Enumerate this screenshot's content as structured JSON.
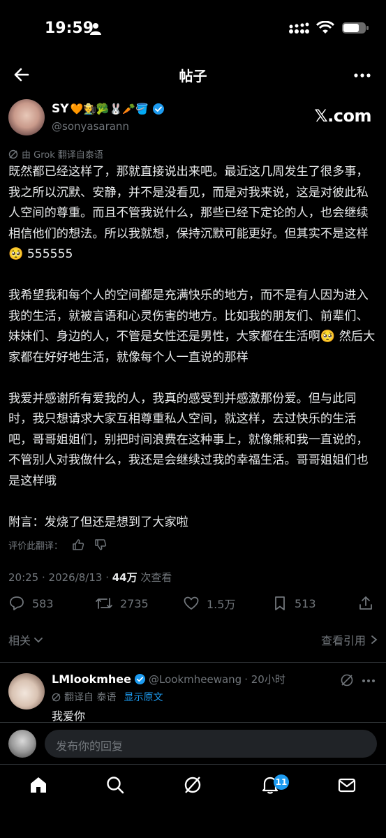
{
  "status": {
    "time": "19:59"
  },
  "header": {
    "title": "帖子"
  },
  "author": {
    "name": "SY",
    "emoji": "🧡🧑‍🌾🥦🐰🥕🪣",
    "handle": "@sonyasarann",
    "brand": "𝕏.com"
  },
  "translation_note": "由 Grok 翻译自泰语",
  "post": {
    "paragraphs": [
      "既然都已经这样了，那就直接说出来吧。最近这几周发生了很多事，我之所以沉默、安静，并不是没看见，而是对我来说，这是对彼此私人空间的尊重。而且不管我说什么，那些已经下定论的人，也会继续相信他们的想法。所以我就想，保持沉默可能更好。但其实不是这样🥺 555555",
      "我希望我和每个人的空间都是充满快乐的地方，而不是有人因为进入我的生活，就被言语和心灵伤害的地方。比如我的朋友们、前辈们、妹妹们、身边的人，不管是女性还是男性，大家都在生活啊🥺 然后大家都在好好地生活，就像每个人一直说的那样",
      "我爱并感谢所有爱我的人，我真的感受到并感激那份爱。但与此同时，我只想请求大家互相尊重私人空间，就这样，去过快乐的生活吧，哥哥姐姐们，别把时间浪费在这种事上，就像熊和我一直说的，不管别人对我做什么，我还是会继续过我的幸福生活。哥哥姐姐们也是这样哦",
      "附言：发烧了但还是想到了大家啦"
    ]
  },
  "rate_label": "评价此翻译：",
  "meta": {
    "time_date": "20:25 · 2026/8/13 · ",
    "views": "44万",
    "views_label": " 次查看"
  },
  "actions": {
    "replies": "583",
    "reposts": "2735",
    "likes": "1.5万",
    "bookmarks": "513"
  },
  "related": {
    "label": "相关",
    "quotes": "查看引用"
  },
  "reply": {
    "name": "LMlookmhee",
    "handle": "@Lookmheewang",
    "time": "· 20小时",
    "translated": "翻译自 泰语",
    "show_original": "显示原文",
    "text": "我爱你"
  },
  "compose": {
    "placeholder": "发布你的回复"
  },
  "tabbar": {
    "notifications_badge": "11"
  },
  "colors": {
    "accent": "#1d9bf0",
    "muted": "#71767b",
    "text": "#e7e9ea"
  }
}
